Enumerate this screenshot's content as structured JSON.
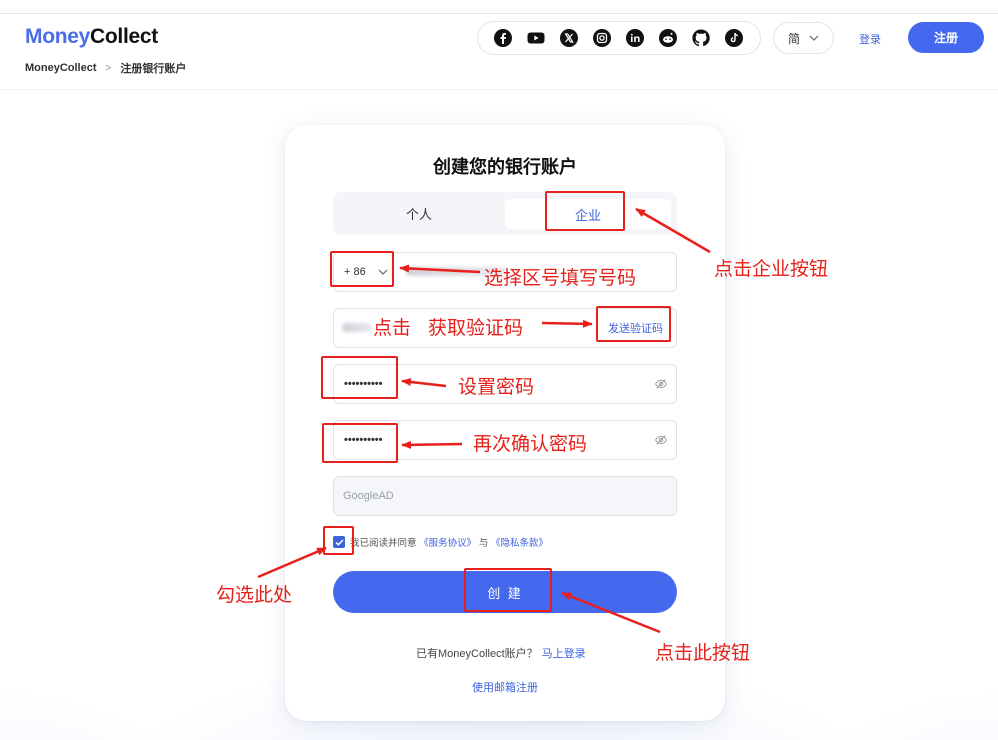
{
  "header": {
    "logo_part1": "Money",
    "logo_part2": "Collect",
    "breadcrumb": [
      "MoneyCollect",
      "注册银行账户"
    ],
    "social_icons": [
      "facebook-icon",
      "youtube-icon",
      "x-icon",
      "instagram-icon",
      "linkedin-icon",
      "reddit-icon",
      "github-icon",
      "tiktok-icon"
    ],
    "language": "简",
    "login_label": "登录",
    "register_label": "注册"
  },
  "form": {
    "title": "创建您的银行账户",
    "tabs": {
      "personal": "个人",
      "business": "企业",
      "selected": "business"
    },
    "phone_prefix": "+ 86",
    "send_code_label": "发送验证码",
    "password_value": "••••••••••",
    "confirm_password_value": "••••••••••",
    "promo_placeholder": "GoogleAD",
    "agree_text": "我已阅读并同意",
    "terms_label": "《服务协议》",
    "and_text": "与",
    "privacy_label": "《隐私条款》",
    "agree_checked": true,
    "create_label": "创 建",
    "have_account_text": "已有MoneyCollect账户？",
    "login_now_label": "马上登录",
    "email_register_label": "使用邮箱注册"
  },
  "annotations": {
    "click_business": "点击企业按钮",
    "select_area_code": "选择区号填写号码",
    "click": "点击",
    "get_code": "获取验证码",
    "set_password": "设置密码",
    "confirm_password": "再次确认密码",
    "check_here": "勾选此处",
    "click_this_button": "点击此按钮"
  },
  "colors": {
    "accent": "#4469ee",
    "annotation": "#e8201b"
  }
}
